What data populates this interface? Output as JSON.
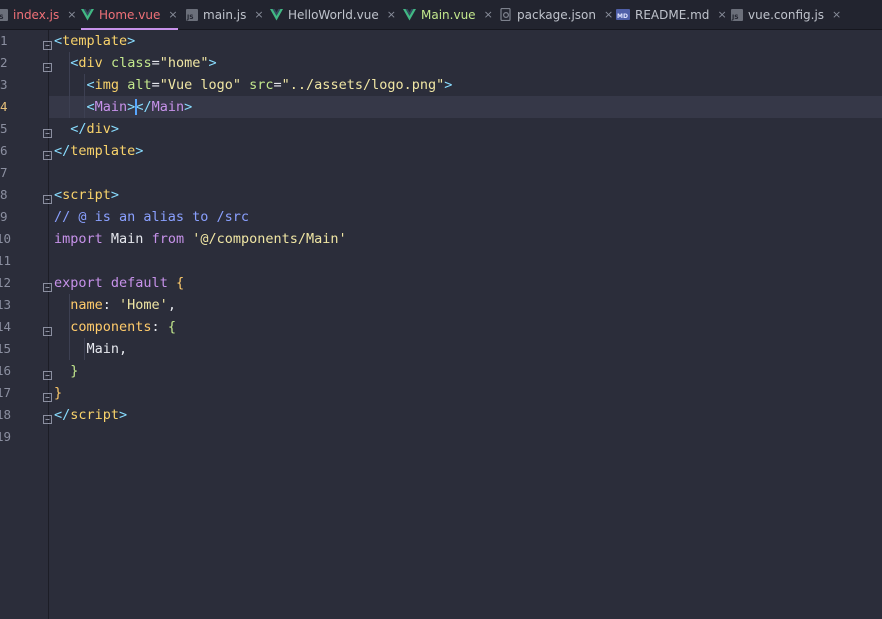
{
  "tabs": [
    {
      "label": "index.js",
      "icon": "js-file-icon",
      "state": "error"
    },
    {
      "label": "Home.vue",
      "icon": "vue-file-icon",
      "state": "active"
    },
    {
      "label": "main.js",
      "icon": "js-file-icon",
      "state": "normal"
    },
    {
      "label": "HelloWorld.vue",
      "icon": "vue-file-icon",
      "state": "normal"
    },
    {
      "label": "Main.vue",
      "icon": "vue-file-icon",
      "state": "vue"
    },
    {
      "label": "package.json",
      "icon": "json-file-icon",
      "state": "normal"
    },
    {
      "label": "README.md",
      "icon": "markdown-file-icon",
      "state": "normal"
    },
    {
      "label": "vue.config.js",
      "icon": "js-file-icon",
      "state": "normal"
    }
  ],
  "tab_close_glyph": "×",
  "js_icon_text": "JS",
  "md_icon_text": "MD",
  "editor": {
    "current_line": 4,
    "line_numbers": [
      "1",
      "2",
      "3",
      "4",
      "5",
      "6",
      "7",
      "8",
      "9",
      "10",
      "11",
      "12",
      "13",
      "14",
      "15",
      "16",
      "17",
      "18",
      "19"
    ],
    "lines": [
      [
        {
          "t": "<",
          "c": "punc"
        },
        {
          "t": "template",
          "c": "tag"
        },
        {
          "t": ">",
          "c": "punc"
        }
      ],
      [
        {
          "t": "  "
        },
        {
          "t": "<",
          "c": "punc"
        },
        {
          "t": "div",
          "c": "tag"
        },
        {
          "t": " "
        },
        {
          "t": "class",
          "c": "attr"
        },
        {
          "t": "=",
          "c": "plain"
        },
        {
          "t": "\"home\"",
          "c": "str"
        },
        {
          "t": ">",
          "c": "punc"
        }
      ],
      [
        {
          "t": "    "
        },
        {
          "t": "<",
          "c": "punc"
        },
        {
          "t": "img",
          "c": "tag"
        },
        {
          "t": " "
        },
        {
          "t": "alt",
          "c": "attr"
        },
        {
          "t": "=",
          "c": "plain"
        },
        {
          "t": "\"Vue logo\"",
          "c": "str"
        },
        {
          "t": " "
        },
        {
          "t": "src",
          "c": "attr"
        },
        {
          "t": "=",
          "c": "plain"
        },
        {
          "t": "\"../assets/logo.png\"",
          "c": "str"
        },
        {
          "t": ">",
          "c": "punc"
        }
      ],
      [
        {
          "t": "    "
        },
        {
          "t": "<",
          "c": "punc"
        },
        {
          "t": "Main",
          "c": "comp"
        },
        {
          "t": ">",
          "c": "punc"
        },
        {
          "t": "</",
          "c": "punc"
        },
        {
          "t": "Main",
          "c": "comp"
        },
        {
          "t": ">",
          "c": "punc"
        }
      ],
      [
        {
          "t": "  "
        },
        {
          "t": "</",
          "c": "punc"
        },
        {
          "t": "div",
          "c": "tag"
        },
        {
          "t": ">",
          "c": "punc"
        }
      ],
      [
        {
          "t": "</",
          "c": "punc"
        },
        {
          "t": "template",
          "c": "tag"
        },
        {
          "t": ">",
          "c": "punc"
        }
      ],
      [],
      [
        {
          "t": "<",
          "c": "punc"
        },
        {
          "t": "script",
          "c": "tag"
        },
        {
          "t": ">",
          "c": "punc"
        }
      ],
      [
        {
          "t": "// @ is an alias to /src",
          "c": "com"
        }
      ],
      [
        {
          "t": "import",
          "c": "kw"
        },
        {
          "t": " "
        },
        {
          "t": "Main",
          "c": "plain"
        },
        {
          "t": " "
        },
        {
          "t": "from",
          "c": "kw"
        },
        {
          "t": " "
        },
        {
          "t": "'@/components/Main'",
          "c": "str"
        }
      ],
      [],
      [
        {
          "t": "export",
          "c": "kw"
        },
        {
          "t": " "
        },
        {
          "t": "default",
          "c": "kw"
        },
        {
          "t": " "
        },
        {
          "t": "{",
          "c": "brace"
        }
      ],
      [
        {
          "t": "  "
        },
        {
          "t": "name",
          "c": "prop"
        },
        {
          "t": ": ",
          "c": "plain"
        },
        {
          "t": "'Home'",
          "c": "str"
        },
        {
          "t": ",",
          "c": "plain"
        }
      ],
      [
        {
          "t": "  "
        },
        {
          "t": "components",
          "c": "prop"
        },
        {
          "t": ": ",
          "c": "plain"
        },
        {
          "t": "{",
          "c": "brace2"
        }
      ],
      [
        {
          "t": "    "
        },
        {
          "t": "Main",
          "c": "plain"
        },
        {
          "t": ",",
          "c": "plain"
        }
      ],
      [
        {
          "t": "  "
        },
        {
          "t": "}",
          "c": "brace2"
        }
      ],
      [
        {
          "t": "}",
          "c": "brace"
        }
      ],
      [
        {
          "t": "</",
          "c": "punc"
        },
        {
          "t": "script",
          "c": "tag"
        },
        {
          "t": ">",
          "c": "punc"
        }
      ],
      []
    ],
    "fold_markers": [
      1,
      2,
      5,
      6,
      8,
      12,
      14,
      16,
      17,
      18
    ]
  },
  "colors": {
    "background": "#2b2d3a",
    "tab_active": "#f07178",
    "caret": "#57a6ff"
  }
}
